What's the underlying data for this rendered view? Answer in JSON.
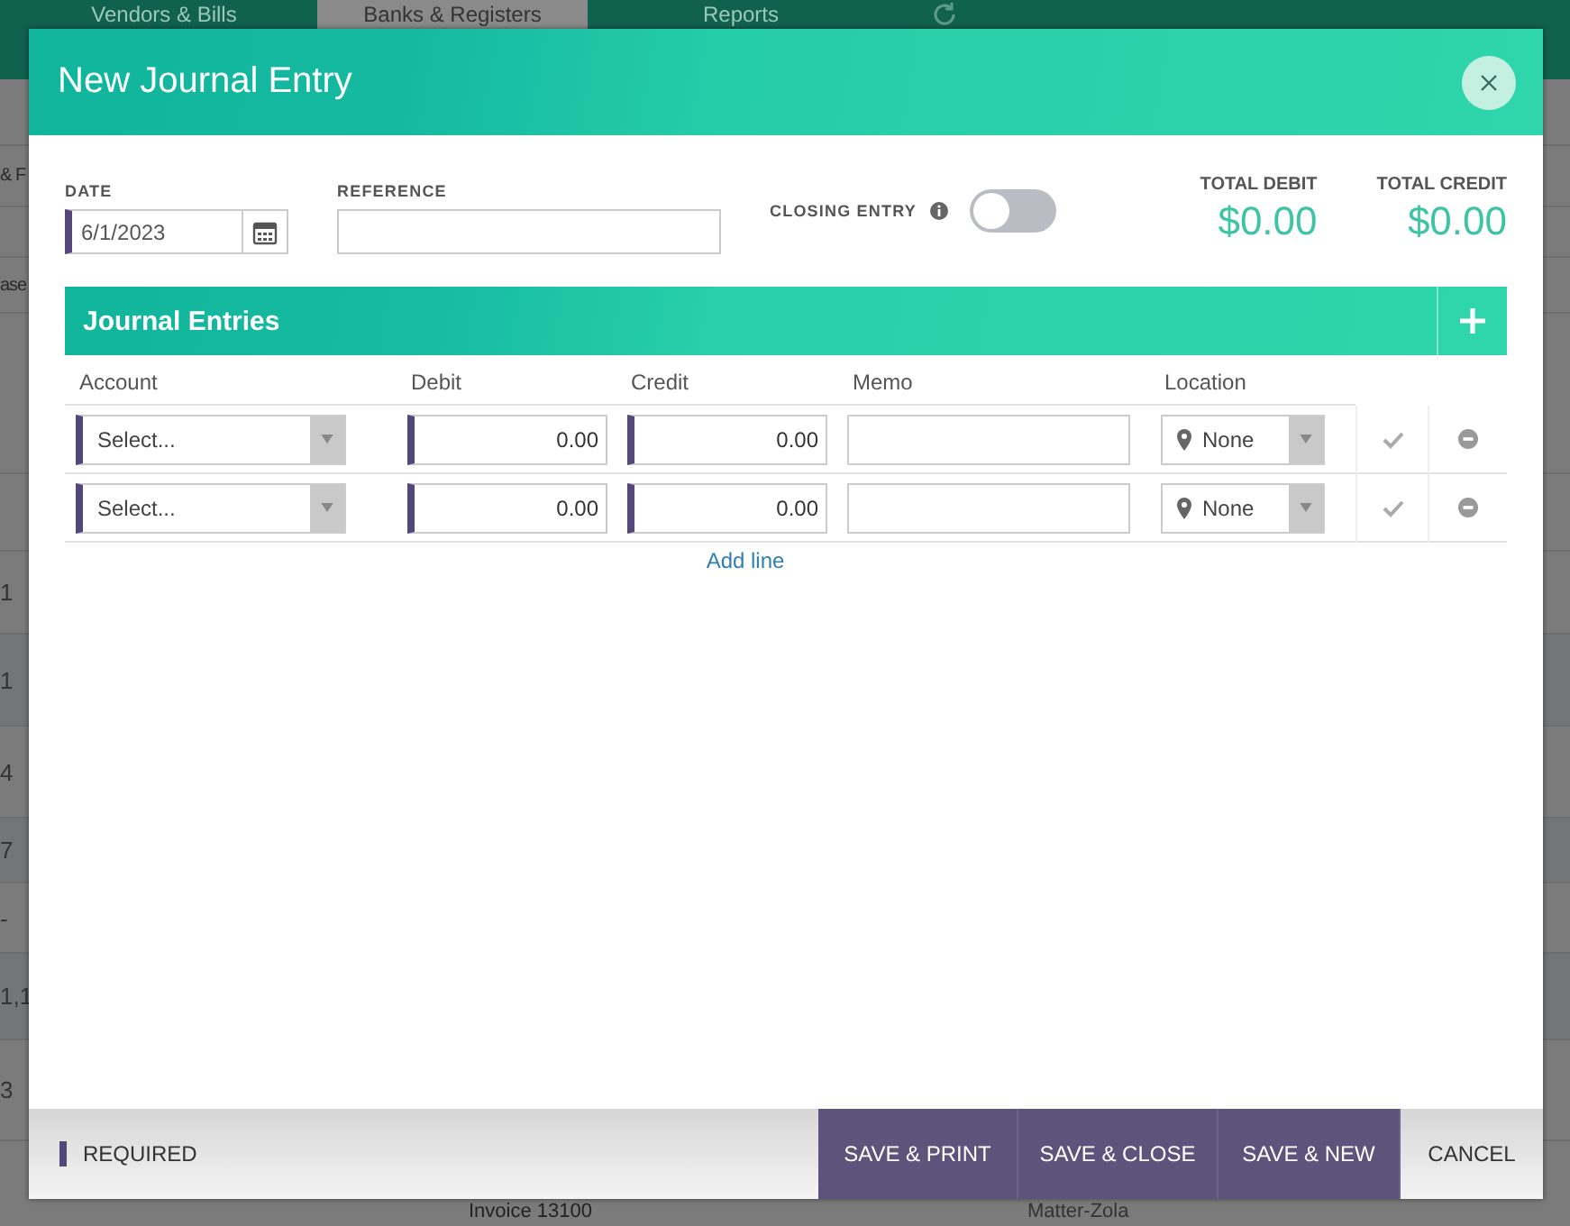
{
  "background": {
    "nav_tabs": [
      {
        "label": "Vendors & Bills",
        "selected": false
      },
      {
        "label": "Banks & Registers",
        "selected": true
      },
      {
        "label": "Reports",
        "selected": false
      }
    ],
    "left_texts": [
      "& F",
      "ase"
    ],
    "right_texts": [
      "1",
      "1",
      "4",
      "7",
      "-",
      "1,1",
      "3"
    ],
    "bottom_texts": [
      "Invoice 13100",
      "Matter-Zola"
    ]
  },
  "dialog": {
    "title": "New Journal Entry",
    "date": {
      "label": "DATE",
      "value": "6/1/2023"
    },
    "reference": {
      "label": "REFERENCE"
    },
    "closing_entry": {
      "label": "CLOSING ENTRY",
      "on": false
    },
    "totals": [
      {
        "label": "TOTAL DEBIT",
        "value": "$0.00"
      },
      {
        "label": "TOTAL CREDIT",
        "value": "$0.00"
      }
    ],
    "section_title": "Journal Entries",
    "columns": [
      "Account",
      "Debit",
      "Credit",
      "Memo",
      "Location"
    ],
    "rows": [
      {
        "account": "Select...",
        "debit": "0.00",
        "credit": "0.00",
        "location": "None"
      },
      {
        "account": "Select...",
        "debit": "0.00",
        "credit": "0.00",
        "location": "None"
      }
    ],
    "add_line": "Add line",
    "required_label": "REQUIRED",
    "buttons": [
      {
        "label": "SAVE & PRINT",
        "kind": "primary"
      },
      {
        "label": "SAVE & CLOSE",
        "kind": "primary"
      },
      {
        "label": "SAVE & NEW",
        "kind": "primary"
      },
      {
        "label": "CANCEL",
        "kind": "plain"
      }
    ]
  }
}
